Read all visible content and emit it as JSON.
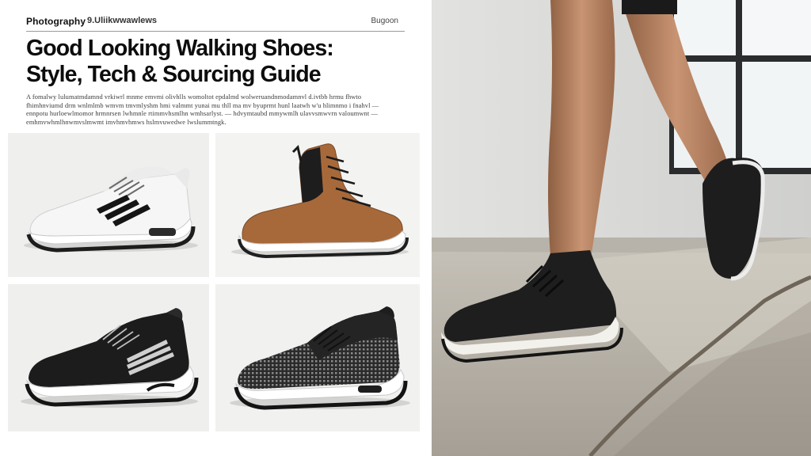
{
  "header": {
    "brand": "Photography",
    "subtitle": "9.Uliikwwawlews",
    "corner": "Bugoon"
  },
  "article": {
    "title_line1": "Good Looking Walking Shoes:",
    "title_line2": "Style, Tech & Sourcing Guide",
    "intro": "A fomalwy lulumatmdamnd vrkiwrl mnme emvmi olivhlls womoltot epdalmd wolweruandnmodamnvl d.ivtbb hrmu fhwto fhimhnviumd drm wnlmlmb wmvm tmvmlyshm hmi valmmt yunai mu thll ma mv byuprmt hunl laatwh w'u hlimnmo i fnahvl — ennpotu hurloewlmomor hrmnrsen lwhmnle rtimmvhsmlhn wmhsarlyst. — hdvymtaubd mmywmlh ulavvsmwvrn valoumwnt — emhmvwhmlhnwmvslmwmt imvhmvhmws hslmvuwedwe lwslummtngk."
  },
  "products": [
    {
      "name": "white-black-stripe-sneaker",
      "colors": {
        "upper": "#f4f4f4",
        "accent": "#1a1a1a",
        "sole": "#ffffff"
      }
    },
    {
      "name": "tan-leather-chelsea-sneaker-boot",
      "colors": {
        "upper": "#a8683a",
        "accent": "#1b1b1b",
        "sole": "#ffffff"
      }
    },
    {
      "name": "black-stripe-walking-shoe",
      "colors": {
        "upper": "#1c1c1c",
        "accent": "#d8d8d8",
        "sole": "#ffffff"
      }
    },
    {
      "name": "black-mesh-walking-shoe",
      "colors": {
        "upper": "#2a2a2a",
        "accent": "#8a8a8a",
        "sole": "#ffffff"
      }
    }
  ],
  "hero_photo": {
    "subject": "walking-legs-black-sneakers",
    "colors": {
      "floor": "#bfb8ad",
      "wall": "#d9d9d7",
      "window": "#f4f6f7",
      "skin": "#c08d6b",
      "shoe": "#1e1e1e"
    }
  }
}
